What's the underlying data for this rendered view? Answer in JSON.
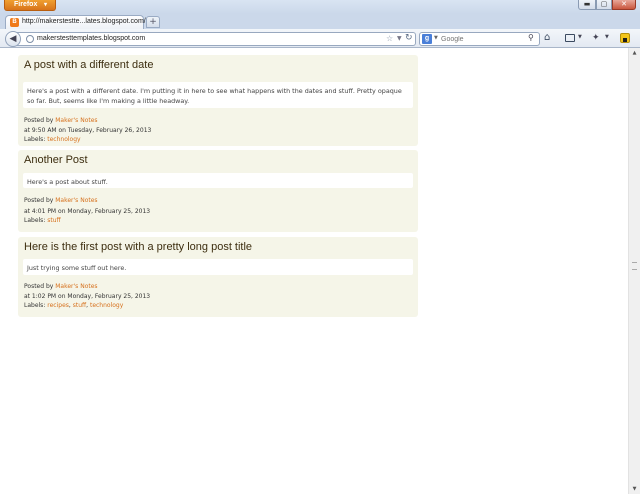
{
  "browser": {
    "menu_label": "Firefox",
    "menu_arrow": "▾",
    "window_controls": {
      "minimize": "▬",
      "maximize": "▢",
      "close": "✕"
    },
    "tab": {
      "title": "http://makerstestte...lates.blogspot.com/",
      "favicon": "B"
    },
    "new_tab_label": "+",
    "url": "makerstesttemplates.blogspot.com",
    "search": {
      "engine_letter": "g",
      "placeholder": "Google"
    },
    "icons": {
      "back": "back-arrow-icon",
      "star": "bookmark-star-icon",
      "reload": "reload-icon",
      "search_go": "magnifier-icon",
      "home": "home-icon",
      "bookmarks": "bookmarks-menu-icon",
      "tools": "tools-icon",
      "addon": "addon-icon"
    }
  },
  "posts": [
    {
      "title": "A post with a different date",
      "body": "Here's a post with a different date. I'm putting it in here to see what happens with the dates and stuff. Pretty opaque so far. But, seems like I'm making a little headway.",
      "posted_by_label": "Posted by",
      "author": "Maker's Notes",
      "timestamp": "at 9:50 AM on Tuesday, February 26, 2013",
      "labels_label": "Labels:",
      "labels": [
        "technology"
      ]
    },
    {
      "title": "Another Post",
      "body": "Here's a post about stuff.",
      "posted_by_label": "Posted by",
      "author": "Maker's Notes",
      "timestamp": "at 4:01 PM on Monday, February 25, 2013",
      "labels_label": "Labels:",
      "labels": [
        "stuff"
      ]
    },
    {
      "title": "Here is the first post with a pretty long post title",
      "body": "Just trying some stuff out here.",
      "posted_by_label": "Posted by",
      "author": "Maker's Notes",
      "timestamp": "at 1:02 PM on Monday, February 25, 2013",
      "labels_label": "Labels:",
      "labels": [
        "recipes",
        "stuff",
        "technology"
      ]
    }
  ],
  "colors": {
    "post_background": "#f5f5e8",
    "link": "#d6701c",
    "firefox_orange": "#e8861f"
  }
}
